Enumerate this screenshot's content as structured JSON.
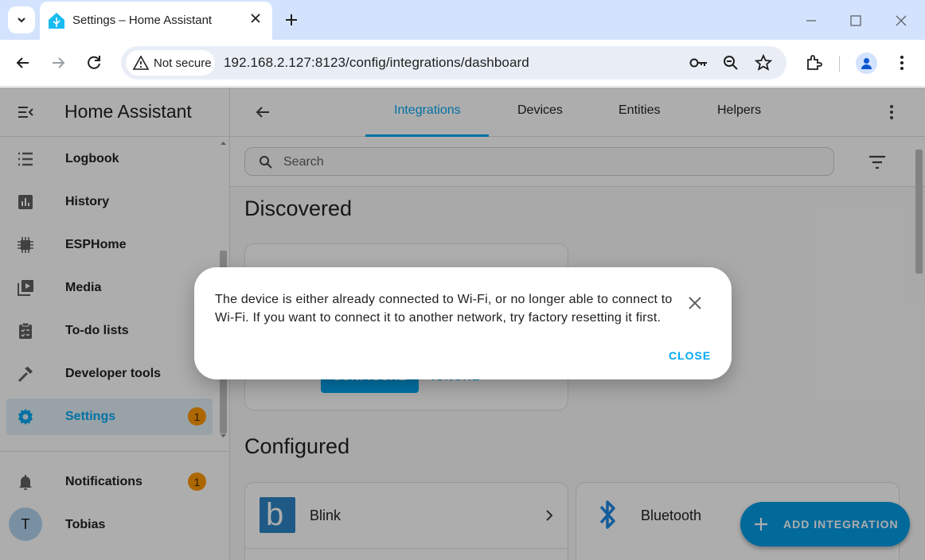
{
  "browser": {
    "tab_title": "Settings – Home Assistant",
    "security_label": "Not secure",
    "url": "192.168.2.127:8123/config/integrations/dashboard"
  },
  "sidebar": {
    "title": "Home Assistant",
    "items": [
      {
        "label": "Logbook",
        "icon": "logbook-icon"
      },
      {
        "label": "History",
        "icon": "history-icon"
      },
      {
        "label": "ESPHome",
        "icon": "esphome-icon"
      },
      {
        "label": "Media",
        "icon": "media-icon"
      },
      {
        "label": "To-do lists",
        "icon": "todo-icon"
      },
      {
        "label": "Developer tools",
        "icon": "hammer-icon"
      },
      {
        "label": "Settings",
        "icon": "gear-icon",
        "badge": "1",
        "active": true
      }
    ],
    "notifications": {
      "label": "Notifications",
      "badge": "1"
    },
    "user": {
      "initial": "T",
      "name": "Tobias"
    }
  },
  "header": {
    "tabs": [
      "Integrations",
      "Devices",
      "Entities",
      "Helpers"
    ],
    "active_tab": "Integrations"
  },
  "search": {
    "placeholder": "Search"
  },
  "sections": {
    "discovered": "Discovered",
    "configured": "Configured"
  },
  "discovered_card": {
    "configure_label": "CONFIGURE",
    "ignore_label": "IGNORE"
  },
  "configured_cards": [
    {
      "name": "Blink"
    },
    {
      "name": "Bluetooth"
    }
  ],
  "fab": {
    "label": "ADD INTEGRATION"
  },
  "dialog": {
    "message": "The device is either already connected to Wi-Fi, or no longer able to connect to Wi-Fi. If you want to connect it to another network, try factory resetting it first.",
    "close_label": "CLOSE"
  },
  "colors": {
    "primary": "#03a9f4",
    "badge": "#ff9800",
    "tabstrip": "#d3e3fd"
  }
}
